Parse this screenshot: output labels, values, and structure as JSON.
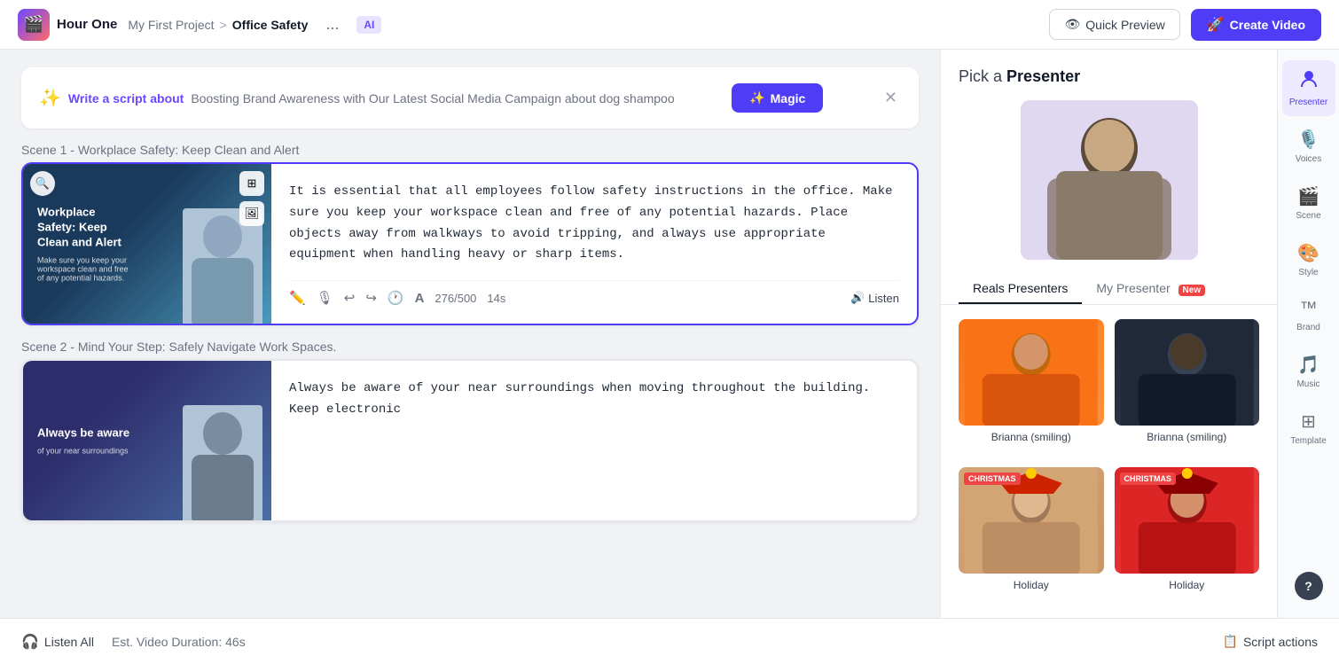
{
  "app": {
    "logo_text": "Hour One",
    "breadcrumb_parent": "My First Project",
    "breadcrumb_sep": ">",
    "breadcrumb_current": "Office Safety",
    "ai_badge": "AI",
    "dots_label": "...",
    "quick_preview_label": "Quick Preview",
    "create_video_label": "Create Video"
  },
  "magic_bar": {
    "icon": "✨",
    "write_script_link": "Write a script about",
    "description": "Boosting Brand Awareness with Our Latest Social Media Campaign about dog shampoo",
    "magic_btn_label": "Magic",
    "magic_btn_icon": "✨"
  },
  "scenes": [
    {
      "label": "Scene 1",
      "title_suffix": " - Workplace Safety: Keep Clean and Alert",
      "thumb_title": "Workplace Safety: Keep Clean and Alert",
      "thumb_subtitle": "Make sure you keep your workspace clean and free of any potential hazards.",
      "text": "It is essential that all employees follow safety instructions in the office. Make sure you keep your workspace clean and free of any potential hazards. Place objects away from walkways to avoid tripping, and always use appropriate equipment when handling heavy or sharp items.",
      "word_count": "276/500",
      "duration": "14s",
      "listen_label": "Listen"
    },
    {
      "label": "Scene 2",
      "title_suffix": " - Mind Your Step: Safely Navigate Work Spaces.",
      "thumb_title": "Always be aware",
      "thumb_subtitle": "of your near surroundings",
      "text": "Always be aware of your near surroundings when moving throughout the building. Keep electronic",
      "word_count": "",
      "duration": "",
      "listen_label": ""
    }
  ],
  "bottom_bar": {
    "listen_all_label": "Listen All",
    "duration_label": "Est. Video Duration: 46s",
    "script_actions_label": "Script actions"
  },
  "right_panel": {
    "pick_label": "Pick a",
    "presenter_label": "Presenter",
    "tabs": [
      {
        "label": "Reals Presenters",
        "active": true
      },
      {
        "label": "My Presenter",
        "active": false,
        "badge": "New"
      }
    ],
    "presenters": [
      {
        "name": "Brianna (smiling)",
        "bg": "orange",
        "christmas": false
      },
      {
        "name": "Brianna (smiling)",
        "bg": "dark",
        "christmas": false
      },
      {
        "name": "Holiday",
        "bg": "tan",
        "christmas": true
      },
      {
        "name": "Holiday",
        "bg": "red",
        "christmas": true
      }
    ]
  },
  "sidebar": {
    "items": [
      {
        "icon": "👤",
        "label": "Presenter",
        "active": true
      },
      {
        "icon": "🎙️",
        "label": "Voices",
        "active": false
      },
      {
        "icon": "🎬",
        "label": "Scene",
        "active": false
      },
      {
        "icon": "🎨",
        "label": "Style",
        "active": false
      },
      {
        "icon": "™️",
        "label": "Brand",
        "active": false
      },
      {
        "icon": "🎵",
        "label": "Music",
        "active": false
      },
      {
        "icon": "⊞",
        "label": "Template",
        "active": false
      }
    ]
  }
}
